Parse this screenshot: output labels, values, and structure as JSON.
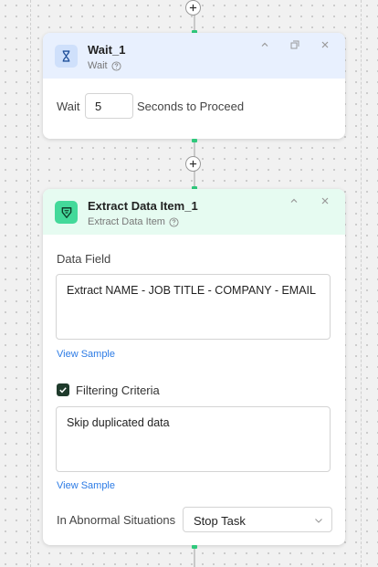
{
  "wait_card": {
    "title": "Wait_1",
    "subtitle": "Wait",
    "label_before": "Wait",
    "seconds_value": "5",
    "label_after": "Seconds to Proceed"
  },
  "extract_card": {
    "title": "Extract Data Item_1",
    "subtitle": "Extract Data Item",
    "data_field_label": "Data Field",
    "data_field_value": "Extract NAME - JOB TITLE - COMPANY - EMAIL",
    "view_sample_1": "View Sample",
    "filtering_checked": true,
    "filtering_label": "Filtering Criteria",
    "filtering_value": "Skip duplicated data",
    "view_sample_2": "View Sample",
    "abnormal_label": "In Abnormal Situations",
    "abnormal_value": "Stop Task"
  },
  "icons": [
    "plus-icon",
    "hourglass-icon",
    "help-icon",
    "collapse-icon",
    "copy-icon",
    "close-icon",
    "extract-icon",
    "checkbox-check-icon",
    "chevron-down-icon"
  ],
  "colors": {
    "wait_header": "#e8f0fe",
    "wait_icon_bg": "#cfe0fb",
    "extract_header": "#e6fbf1",
    "extract_icon_bg": "#43d99a",
    "connector_accent": "#2fc97c",
    "link": "#2c7be5"
  }
}
